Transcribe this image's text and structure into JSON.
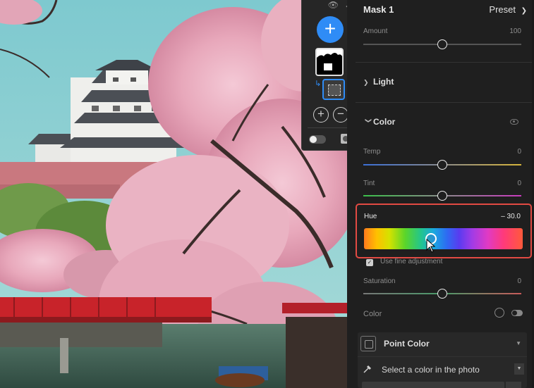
{
  "mask_panel": {
    "icons": [
      "eye-icon",
      "arrow-left-icon",
      "add-icon",
      "mask-thumbnail",
      "subtract-mask-icon",
      "add-circle-icon",
      "minus-circle-icon",
      "toggle-icon",
      "overlay-icon"
    ]
  },
  "panel": {
    "mask_title": "Mask 1",
    "preset_label": "Preset",
    "amount": {
      "label": "Amount",
      "value": "100",
      "fraction": 0.5
    },
    "light_section": "Light",
    "color_section": "Color",
    "temp": {
      "label": "Temp",
      "value": "0",
      "fraction": 0.5
    },
    "tint": {
      "label": "Tint",
      "value": "0",
      "fraction": 0.5
    },
    "hue": {
      "label": "Hue",
      "value": "– 30.0",
      "fraction": 0.42
    },
    "fine_adjustment": "Use fine adjustment",
    "saturation": {
      "label": "Saturation",
      "value": "0",
      "fraction": 0.5
    },
    "color_label": "Color",
    "point_color": {
      "title": "Point Color",
      "select_text": "Select a color in the photo"
    }
  },
  "colors": {
    "accent": "#2f8cf6",
    "highlight": "#e24a43"
  }
}
